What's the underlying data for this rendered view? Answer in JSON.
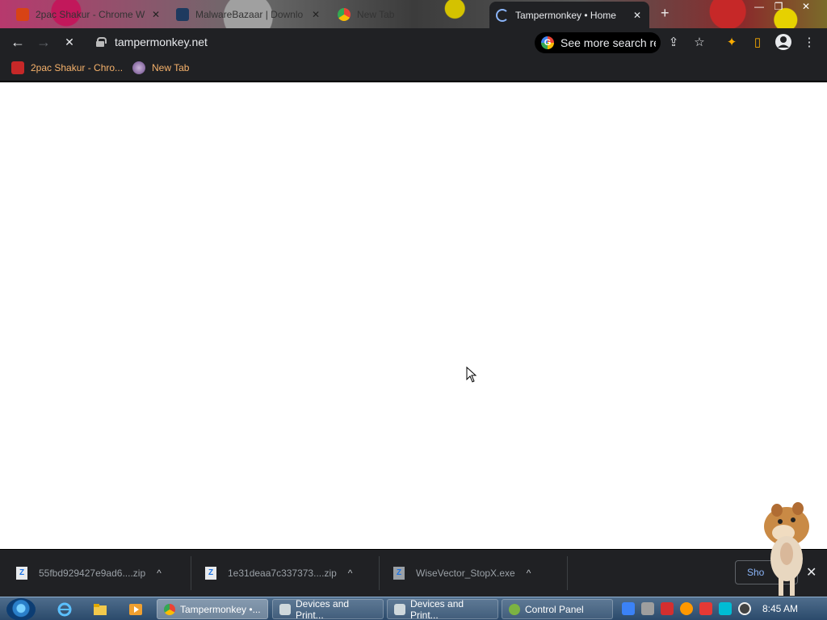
{
  "window": {
    "tabs": [
      {
        "title": "2pac Shakur - Chrome W",
        "favicon": "gift-icon"
      },
      {
        "title": "MalwareBazaar | Downlo",
        "favicon": "malwarebazaar-icon"
      },
      {
        "title": "New Tab",
        "favicon": "chrome-icon"
      },
      {
        "title": "Tampermonkey • Home",
        "favicon": "loading-spinner-icon",
        "active": true
      }
    ],
    "new_tab_symbol": "+",
    "controls": {
      "minimize": "—",
      "restore": "❐",
      "close": "✕"
    }
  },
  "toolbar": {
    "back": "←",
    "forward": "→",
    "reload": "✕",
    "url": "tampermonkey.net",
    "search_pill": "See more search re",
    "share": "⇪",
    "bookmark": "☆",
    "extensions": "✦",
    "sidepanel": "▯",
    "menu": "⋮"
  },
  "bookmarks": [
    {
      "label": "2pac Shakur - Chro...",
      "icon": "gift-icon"
    },
    {
      "label": "New Tab",
      "icon": "globe-icon"
    }
  ],
  "downloads": {
    "items": [
      {
        "filename": "55fbd929427e9ad6....zip",
        "icon": "zip-file-icon"
      },
      {
        "filename": "1e31deaa7c337373....zip",
        "icon": "zip-file-icon"
      },
      {
        "filename": "WiseVector_StopX.exe",
        "icon": "exe-file-icon"
      }
    ],
    "caret": "^",
    "show_all": "Sho",
    "close": "✕"
  },
  "taskbar": {
    "items": [
      {
        "label": "Tampermonkey •...",
        "icon": "chrome-icon",
        "active": true
      },
      {
        "label": "Devices and Print...",
        "icon": "printer-icon"
      },
      {
        "label": "Devices and Print...",
        "icon": "printer-icon"
      },
      {
        "label": "Control Panel",
        "icon": "control-panel-icon"
      }
    ],
    "clock": "8:45 AM"
  },
  "colors": {
    "toolbar_bg": "#202124",
    "bookmark_text": "#f6b26b",
    "link_blue": "#8ab4f8"
  }
}
